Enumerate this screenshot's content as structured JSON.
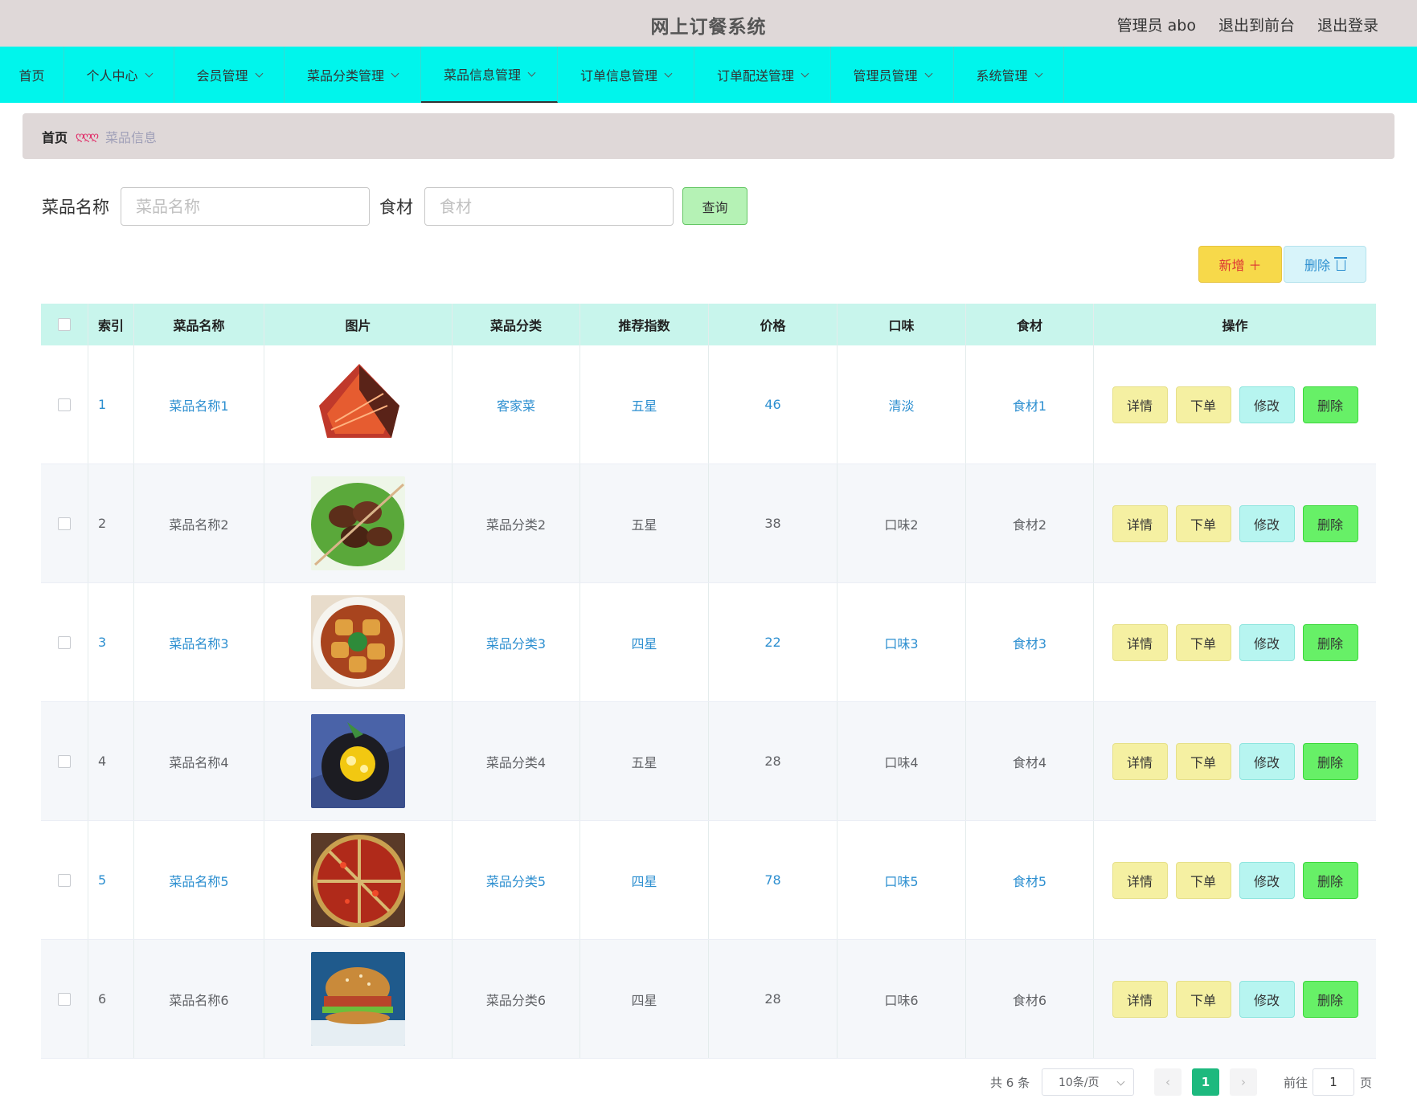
{
  "header": {
    "title": "网上订餐系统",
    "user": "管理员 abo",
    "to_front": "退出到前台",
    "logout": "退出登录"
  },
  "nav": [
    {
      "label": "首页",
      "dropdown": false
    },
    {
      "label": "个人中心",
      "dropdown": true
    },
    {
      "label": "会员管理",
      "dropdown": true
    },
    {
      "label": "菜品分类管理",
      "dropdown": true
    },
    {
      "label": "菜品信息管理",
      "dropdown": true,
      "active": true
    },
    {
      "label": "订单信息管理",
      "dropdown": true
    },
    {
      "label": "订单配送管理",
      "dropdown": true
    },
    {
      "label": "管理员管理",
      "dropdown": true
    },
    {
      "label": "系统管理",
      "dropdown": true
    }
  ],
  "breadcrumb": {
    "home": "首页",
    "separator": "ღღღ",
    "current": "菜品信息"
  },
  "search": {
    "name_label": "菜品名称",
    "name_placeholder": "菜品名称",
    "name_value": "",
    "ingredient_label": "食材",
    "ingredient_placeholder": "食材",
    "ingredient_value": "",
    "query_button": "查询"
  },
  "actions": {
    "add": "新增 ＋",
    "delete": "删除"
  },
  "table": {
    "headers": [
      "索引",
      "菜品名称",
      "图片",
      "菜品分类",
      "推荐指数",
      "价格",
      "口味",
      "食材",
      "操作"
    ],
    "row_buttons": [
      "详情",
      "下单",
      "修改",
      "删除"
    ],
    "rows": [
      {
        "index": "1",
        "name": "菜品名称1",
        "image": "food-image-sauced-beef",
        "category": "客家菜",
        "rating": "五星",
        "price": "46",
        "flavor": "清淡",
        "ingredient": "食材1"
      },
      {
        "index": "2",
        "name": "菜品名称2",
        "image": "food-image-skewers",
        "category": "菜品分类2",
        "rating": "五星",
        "price": "38",
        "flavor": "口味2",
        "ingredient": "食材2"
      },
      {
        "index": "3",
        "name": "菜品名称3",
        "image": "food-image-stuffed-tofu",
        "category": "菜品分类3",
        "rating": "四星",
        "price": "22",
        "flavor": "口味3",
        "ingredient": "食材3"
      },
      {
        "index": "4",
        "name": "菜品名称4",
        "image": "food-image-mango-dish",
        "category": "菜品分类4",
        "rating": "五星",
        "price": "28",
        "flavor": "口味4",
        "ingredient": "食材4"
      },
      {
        "index": "5",
        "name": "菜品名称5",
        "image": "food-image-hotpot",
        "category": "菜品分类5",
        "rating": "四星",
        "price": "78",
        "flavor": "口味5",
        "ingredient": "食材5"
      },
      {
        "index": "6",
        "name": "菜品名称6",
        "image": "food-image-burger",
        "category": "菜品分类6",
        "rating": "四星",
        "price": "28",
        "flavor": "口味6",
        "ingredient": "食材6"
      }
    ]
  },
  "pagination": {
    "total": "共 6 条",
    "page_size": "10条/页",
    "current_page": "1",
    "goto_label": "前往",
    "goto_value": "1",
    "page_unit": "页"
  },
  "colors": {
    "nav_bg": "#00f5ec",
    "header_bg": "#dfd8d8",
    "table_head_bg": "#c8f5ec",
    "link_blue": "#2d8fd0",
    "active_page": "#1db97e"
  }
}
